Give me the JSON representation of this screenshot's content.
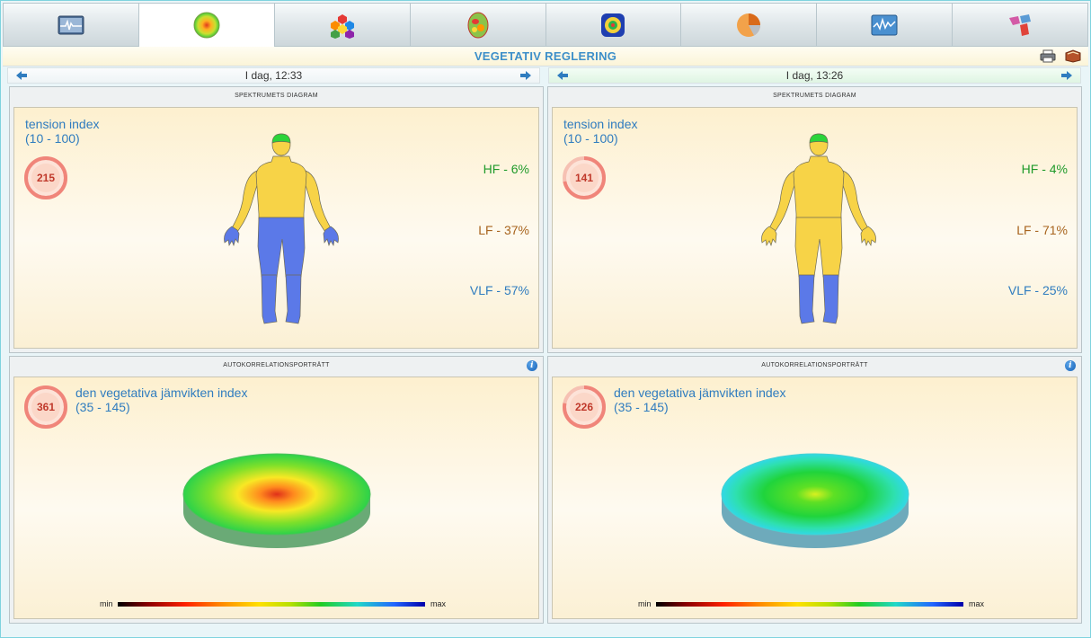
{
  "toolbar": {
    "tabs": [
      {
        "icon": "ecg-monitor-icon"
      },
      {
        "icon": "heat-spot-icon",
        "active": true
      },
      {
        "icon": "hexagon-cluster-icon"
      },
      {
        "icon": "brain-map-icon"
      },
      {
        "icon": "chakra-circle-icon"
      },
      {
        "icon": "pie-chart-icon"
      },
      {
        "icon": "rhythm-graph-icon"
      },
      {
        "icon": "puzzle-pieces-icon"
      }
    ]
  },
  "header": {
    "title": "VEGETATIV REGLERING",
    "print_icon": "printer-icon",
    "book_icon": "book-icon"
  },
  "sessions": [
    {
      "date_label": "I dag, 12:33",
      "spectrum": {
        "header": "SPEKTRUMETS DIAGRAM",
        "index_name": "tension index",
        "index_range": "(10 - 100)",
        "index_value": "215",
        "gauge_fraction": 1.0,
        "hf": "HF - 6%",
        "lf": "LF - 37%",
        "vlf": "VLF - 57%",
        "body_colors": {
          "head": "#2bd43a",
          "torso": "#f7d347",
          "arms": "#f7d347",
          "hands": "#5b79e8",
          "legs": "#5b79e8",
          "upper_legs": "#5b79e8"
        }
      },
      "autocorr": {
        "header": "AUTOKORRELATIONSPORTRÄTT",
        "index_name": "den vegetativa jämvikten index",
        "index_range": "(35 - 145)",
        "index_value": "361",
        "gauge_fraction": 1.0,
        "scale_min": "min",
        "scale_max": "max"
      }
    },
    {
      "date_label": "I dag, 13:26",
      "spectrum": {
        "header": "SPEKTRUMETS DIAGRAM",
        "index_name": "tension index",
        "index_range": "(10 - 100)",
        "index_value": "141",
        "gauge_fraction": 0.72,
        "hf": "HF - 4%",
        "lf": "LF - 71%",
        "vlf": "VLF - 25%",
        "body_colors": {
          "head": "#2bd43a",
          "torso": "#f7d347",
          "arms": "#f7d347",
          "hands": "#f7d347",
          "legs": "#5b79e8",
          "upper_legs": "#f7d347"
        }
      },
      "autocorr": {
        "header": "AUTOKORRELATIONSPORTRÄTT",
        "index_name": "den vegetativa jämvikten index",
        "index_range": "(35 - 145)",
        "index_value": "226",
        "gauge_fraction": 0.78,
        "scale_min": "min",
        "scale_max": "max"
      }
    }
  ],
  "colors": {
    "title": "#3d8fc9",
    "index_text": "#2f7cbf",
    "gauge_ring": "#f0857a",
    "gauge_value": "#c0392b"
  }
}
